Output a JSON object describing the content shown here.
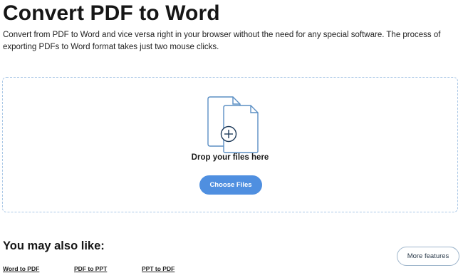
{
  "header": {
    "title": "Convert PDF to Word",
    "description": "Convert from PDF to Word and vice versa right in your browser without the need for any special software. The process of exporting PDFs to Word format takes just two mouse clicks."
  },
  "dropzone": {
    "label": "Drop your files here",
    "button_label": "Choose Files",
    "icon": "files-plus-icon"
  },
  "related": {
    "title": "You may also like:",
    "more_button": "More features",
    "links": [
      {
        "label": "Word to PDF"
      },
      {
        "label": "PDF to PPT"
      },
      {
        "label": "PPT to PDF"
      }
    ]
  },
  "colors": {
    "accent": "#4f8fe0",
    "icon_stroke": "#5b8fc4",
    "dropzone_border": "#a9c7e6"
  }
}
